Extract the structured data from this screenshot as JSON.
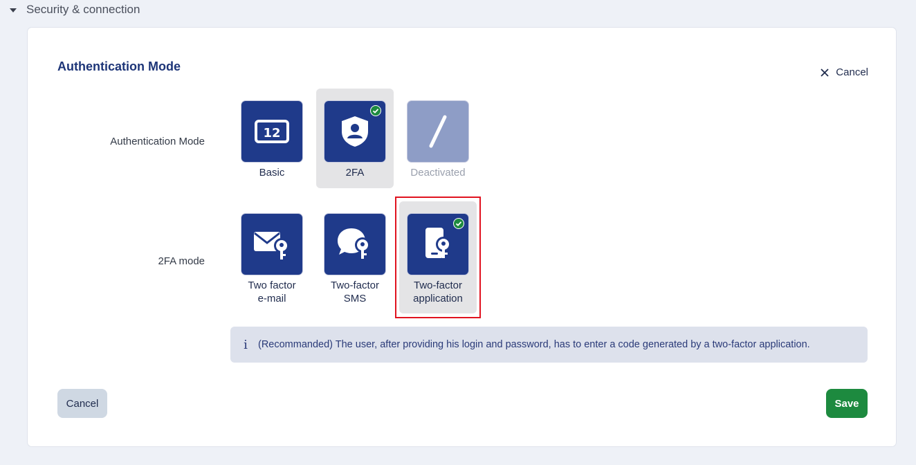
{
  "section": {
    "title": "Security & connection"
  },
  "card": {
    "title": "Authentication Mode",
    "top_cancel_label": "Cancel"
  },
  "auth_mode": {
    "label": "Authentication Mode",
    "options": [
      {
        "label": "Basic",
        "icon": "keypad-code-icon",
        "selected": false,
        "disabled": false
      },
      {
        "label": "2FA",
        "icon": "shield-user-icon",
        "selected": true,
        "disabled": false
      },
      {
        "label": "Deactivated",
        "icon": "slash-icon",
        "selected": false,
        "disabled": true
      }
    ]
  },
  "twofa_mode": {
    "label": "2FA mode",
    "options": [
      {
        "label_line1": "Two factor",
        "label_line2": "e-mail",
        "icon": "envelope-key-icon",
        "selected": false
      },
      {
        "label_line1": "Two-factor",
        "label_line2": "SMS",
        "icon": "chat-key-icon",
        "selected": false
      },
      {
        "label_line1": "Two-factor",
        "label_line2": "application",
        "icon": "phone-key-icon",
        "selected": true
      }
    ]
  },
  "info": {
    "icon": "info-icon",
    "text": "(Recommanded) The user, after providing his login and password, has to enter a code generated by a two-factor application."
  },
  "footer": {
    "cancel_label": "Cancel",
    "save_label": "Save"
  },
  "colors": {
    "primary": "#1f3a8a",
    "save": "#1d8a3f",
    "check": "#1d8a3f",
    "highlight": "#e0121f"
  }
}
